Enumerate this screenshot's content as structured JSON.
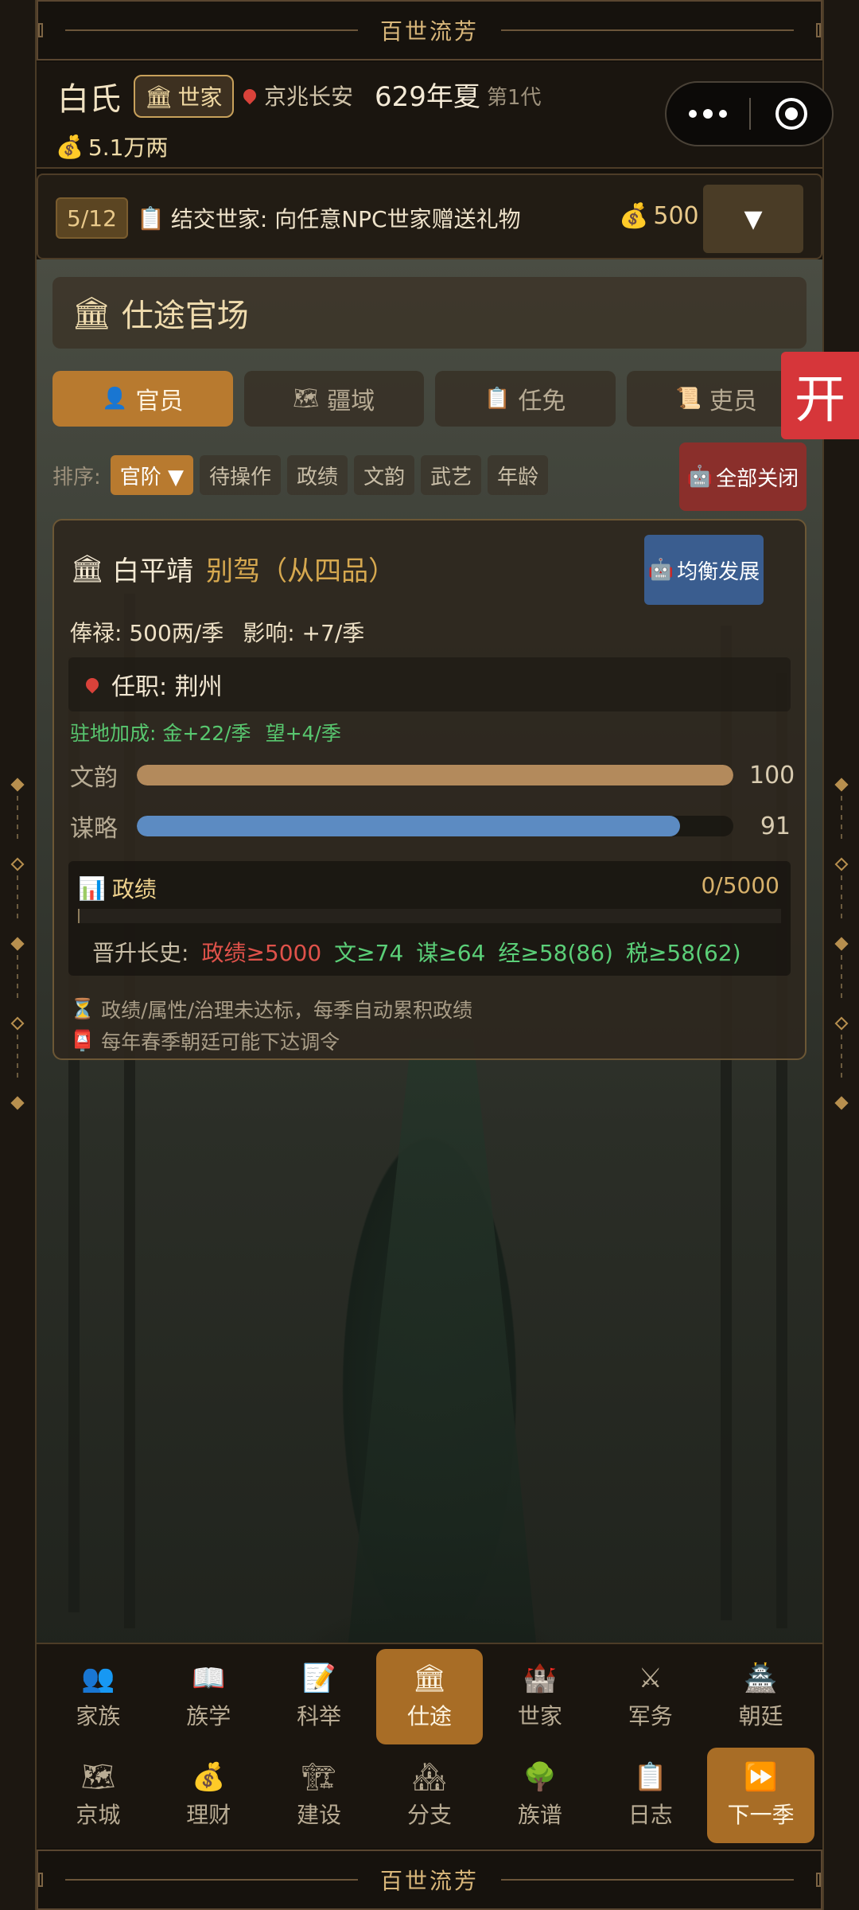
{
  "banner": {
    "title": "百世流芳"
  },
  "header": {
    "surname": "白氏",
    "clan_type": "世家",
    "location": "京兆长安",
    "date": "629年夏",
    "generation": "第1代",
    "money": "5.1万两"
  },
  "quest": {
    "progress": "5/12",
    "text": "结交世家: 向任意NPC世家赠送礼物",
    "reward": "500",
    "toggle": "▼"
  },
  "panel": {
    "title": "仕途官场",
    "side_tab": "开",
    "tabs": [
      {
        "label": "官员",
        "icon": "👤"
      },
      {
        "label": "疆域",
        "icon": "🗺"
      },
      {
        "label": "任免",
        "icon": "📋"
      },
      {
        "label": "吏员",
        "icon": "📜"
      }
    ],
    "sort_label": "排序:",
    "sort_selected": "官阶 ▼",
    "sort_options": [
      "待操作",
      "政绩",
      "文韵",
      "武艺",
      "年龄"
    ],
    "close_all": "全部关闭"
  },
  "official": {
    "name": "白平靖",
    "rank": "别驾（从四品）",
    "balance_btn": "均衡发展",
    "salary": "俸禄: 500两/季",
    "influence": "影响: +7/季",
    "post": "任职: 荆州",
    "bonus_label": "驻地加成: 金+22/季",
    "bonus_prestige": "望+4/季",
    "stats": [
      {
        "label": "文韵",
        "value": 100,
        "color": "#b38a5c"
      },
      {
        "label": "谋略",
        "value": 91,
        "color": "#5c8bc2"
      }
    ],
    "perf_title": "政绩",
    "perf_value": "0/5000",
    "perf_progress": 0,
    "promo_label": "晋升长史:",
    "promo_reqs": [
      {
        "text": "政绩≥5000",
        "status": "bad"
      },
      {
        "text": "文≥74",
        "status": "ok"
      },
      {
        "text": "谋≥64",
        "status": "ok"
      },
      {
        "text": "经≥58(86)",
        "status": "ok"
      },
      {
        "text": "税≥58(62)",
        "status": "ok"
      }
    ],
    "note1": "政绩/属性/治理未达标，每季自动累积政绩",
    "note2": "每年春季朝廷可能下达调令"
  },
  "nav": {
    "row1": [
      {
        "label": "家族",
        "icon": "👥"
      },
      {
        "label": "族学",
        "icon": "📖"
      },
      {
        "label": "科举",
        "icon": "📝"
      },
      {
        "label": "仕途",
        "icon": "🏛"
      },
      {
        "label": "世家",
        "icon": "🏰"
      },
      {
        "label": "军务",
        "icon": "⚔"
      },
      {
        "label": "朝廷",
        "icon": "🏯"
      }
    ],
    "row2": [
      {
        "label": "京城",
        "icon": "🗺"
      },
      {
        "label": "理财",
        "icon": "💰"
      },
      {
        "label": "建设",
        "icon": "🏗"
      },
      {
        "label": "分支",
        "icon": "🏘"
      },
      {
        "label": "族谱",
        "icon": "🌳"
      },
      {
        "label": "日志",
        "icon": "📋"
      },
      {
        "label": "下一季",
        "icon": "⏩"
      }
    ]
  }
}
